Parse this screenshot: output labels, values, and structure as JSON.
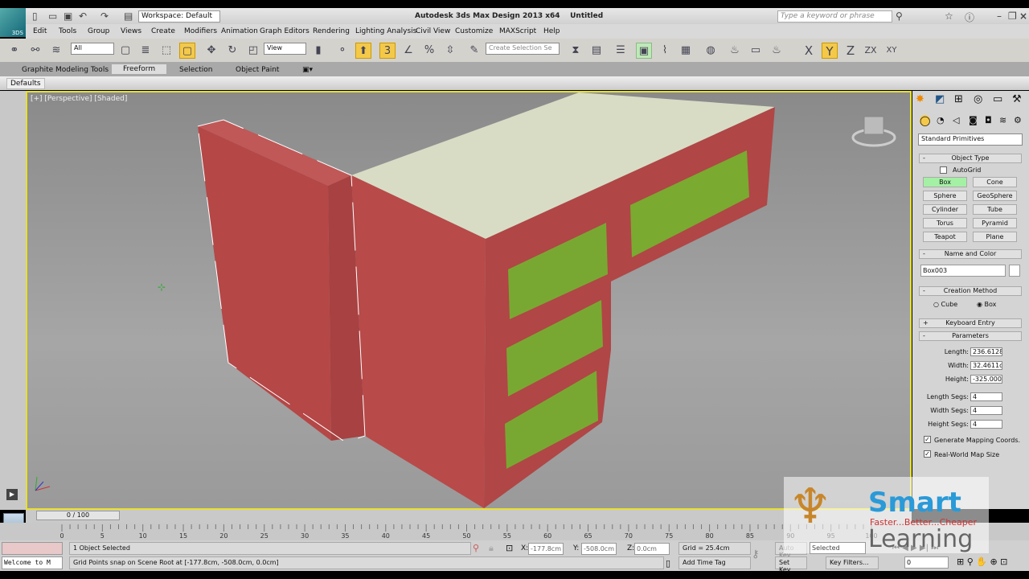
{
  "app": {
    "title": "Autodesk 3ds Max Design 2013 x64",
    "document": "Untitled",
    "logo_text": "3DS",
    "workspace": "Workspace: Default",
    "search_placeholder": "Type a keyword or phrase"
  },
  "menu": [
    "Edit",
    "Tools",
    "Group",
    "Views",
    "Create",
    "Modifiers",
    "Animation",
    "Graph Editors",
    "Rendering",
    "Lighting Analysis",
    "Civil View",
    "Customize",
    "MAXScript",
    "Help"
  ],
  "toolbar": {
    "filter": "All",
    "ref_coord": "View",
    "selection_set_placeholder": "Create Selection Se",
    "snap_value": "3",
    "axes": [
      "X",
      "Y",
      "Z",
      "ZX",
      "XY"
    ],
    "active_axis": "Y"
  },
  "ribbon": {
    "tabs": [
      "Graphite Modeling Tools",
      "Freeform",
      "Selection",
      "Object Paint"
    ],
    "active": "Freeform",
    "defaults": "Defaults"
  },
  "viewport": {
    "label": "[+] [Perspective] [Shaded]",
    "colors": {
      "body": "#b34a4a",
      "top": "#d8dcc4",
      "drawer": "#79a832",
      "border": "#e8e030"
    }
  },
  "panel": {
    "category": "Standard Primitives",
    "object_type": {
      "title": "Object Type",
      "autogrid": "AutoGrid",
      "autogrid_checked": false,
      "buttons": [
        "Box",
        "Cone",
        "Sphere",
        "GeoSphere",
        "Cylinder",
        "Tube",
        "Torus",
        "Pyramid",
        "Teapot",
        "Plane"
      ],
      "selected": "Box"
    },
    "name_color": {
      "title": "Name and Color",
      "name": "Box003"
    },
    "creation": {
      "title": "Creation Method",
      "options": [
        "Cube",
        "Box"
      ],
      "selected": "Box"
    },
    "keyboard_entry": "Keyboard Entry",
    "parameters": {
      "title": "Parameters",
      "length_label": "Length:",
      "length": "236.6128",
      "width_label": "Width:",
      "width": "32.4611c",
      "height_label": "Height:",
      "height": "-325.0000",
      "length_segs_label": "Length Segs:",
      "length_segs": "4",
      "width_segs_label": "Width Segs:",
      "width_segs": "4",
      "height_segs_label": "Height Segs:",
      "height_segs": "4",
      "gen_mapping": "Generate Mapping Coords.",
      "real_world": "Real-World Map Size"
    }
  },
  "timeline": {
    "frame": "0 / 100",
    "ticks": [
      "0",
      "5",
      "10",
      "15",
      "20",
      "25",
      "30",
      "35",
      "40",
      "45",
      "50",
      "55",
      "60",
      "65",
      "70",
      "75",
      "80",
      "85",
      "90",
      "95",
      "100"
    ]
  },
  "status": {
    "selected": "1 Object Selected",
    "prompt": "Grid Points snap on Scene Root at [-177.8cm, -508.0cm, 0.0cm]",
    "maxscript": "Welcome to M",
    "x_label": "X:",
    "x": "-177.8cm",
    "y_label": "Y:",
    "y": "-508.0cm",
    "z_label": "Z:",
    "z": "0.0cm",
    "grid": "Grid = 25.4cm",
    "add_time_tag": "Add Time Tag",
    "auto_key": "Auto Key",
    "set_key": "Set Key",
    "key_mode": "Selected",
    "key_filters": "Key Filters...",
    "current_frame": "0"
  },
  "watermark": {
    "brand": "Smart",
    "tagline": "Faster...Better...Cheaper",
    "word": "Learning"
  }
}
